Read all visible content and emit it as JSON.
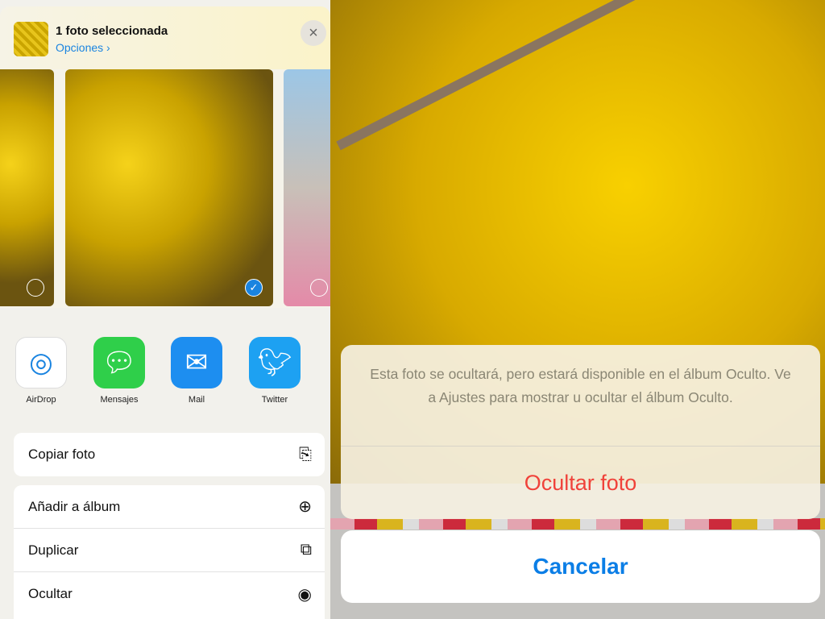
{
  "share_sheet": {
    "title": "1 foto seleccionada",
    "options_label": "Opciones ›",
    "close_icon": "×",
    "apps": [
      {
        "label": "AirDrop",
        "icon": "airdrop-icon",
        "color": "#1a84e0"
      },
      {
        "label": "Mensajes",
        "icon": "messages-icon",
        "color": "#2fcf4a"
      },
      {
        "label": "Mail",
        "icon": "mail-icon",
        "color": "#1d8ef0"
      },
      {
        "label": "Twitter",
        "icon": "twitter-icon",
        "color": "#1da1f2"
      }
    ],
    "actions": [
      {
        "label": "Copiar foto",
        "icon": "⎘"
      },
      {
        "label": "Añadir a álbum",
        "icon": "⊕"
      },
      {
        "label": "Duplicar",
        "icon": "⧉"
      },
      {
        "label": "Ocultar",
        "icon": "◉"
      }
    ]
  },
  "alert": {
    "message": "Esta foto se ocultará, pero estará disponible en el álbum Oculto. Ve a Ajustes para mostrar u ocultar el álbum Oculto.",
    "action_label": "Ocultar foto",
    "cancel_label": "Cancelar",
    "destructive_color": "#f0423a",
    "accent_color": "#0b7ee6"
  }
}
